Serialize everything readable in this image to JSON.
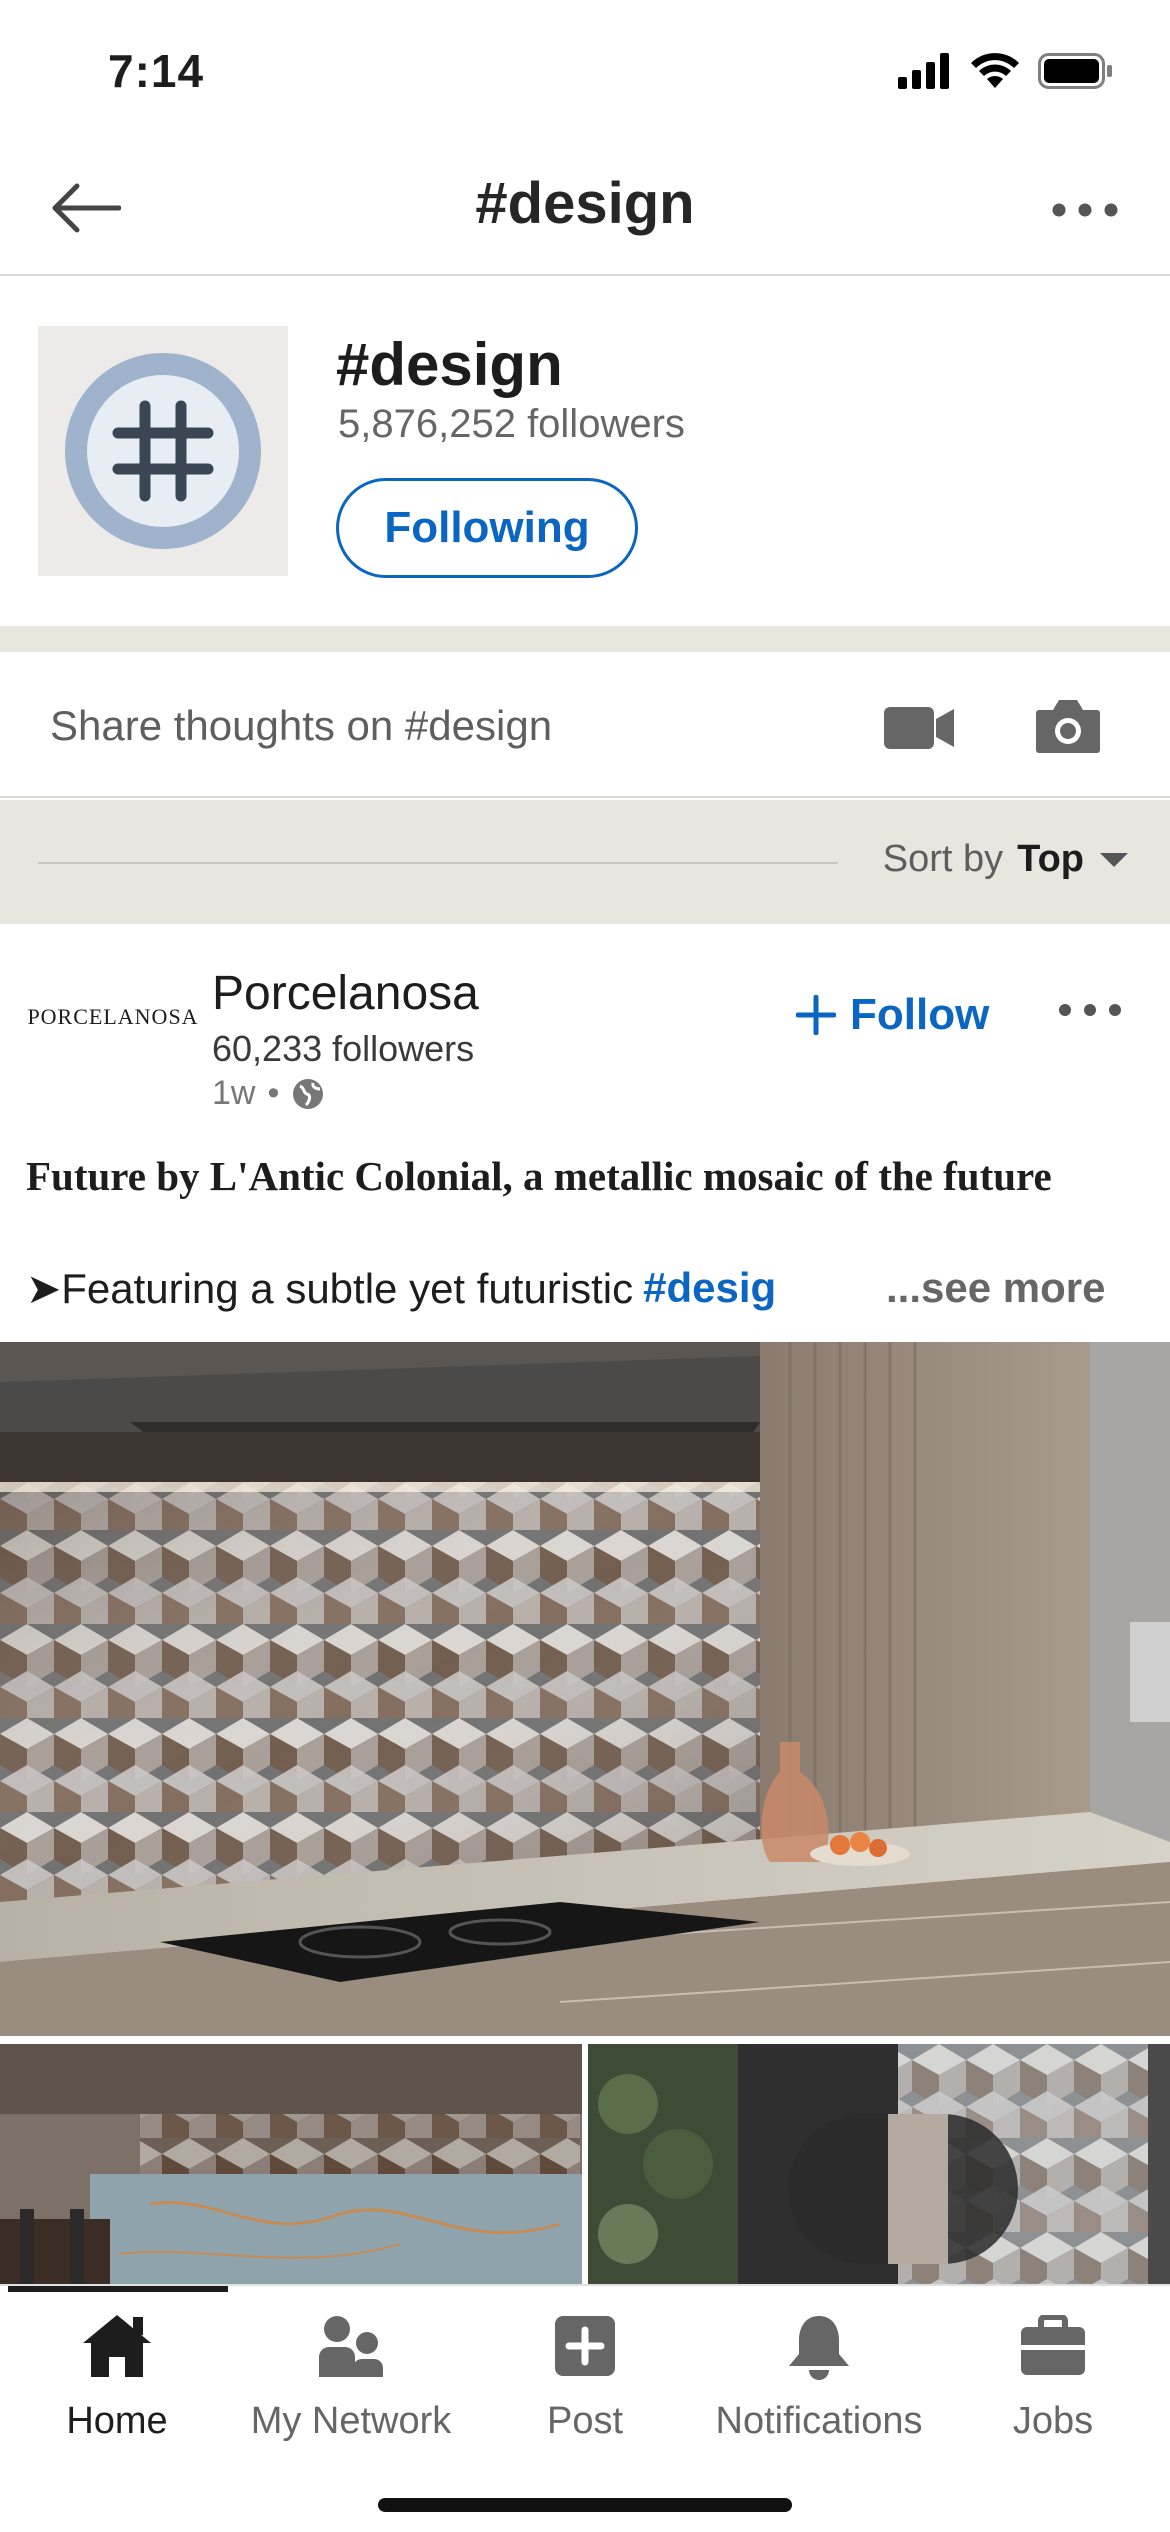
{
  "status_bar": {
    "time": "7:14"
  },
  "header": {
    "title": "#design",
    "back_icon": "arrow-left-icon",
    "more_icon": "ellipsis-icon"
  },
  "hashtag": {
    "name": "#design",
    "followers": "5,876,252 followers",
    "following_label": "Following",
    "logo_icon": "hashtag-icon"
  },
  "share": {
    "placeholder": "Share thoughts on #design",
    "video_icon": "video-camera-icon",
    "camera_icon": "camera-icon"
  },
  "sort": {
    "label": "Sort by",
    "value": "Top"
  },
  "post": {
    "company_logo_text": "PORCELANOSA",
    "company": "Porcelanosa",
    "followers": "60,233 followers",
    "age": "1w",
    "separator": "•",
    "visibility_icon": "globe-icon",
    "follow_label": "Follow",
    "headline": "Future by L'Antic Colonial, a metallic mosaic of the future",
    "body_prefix": "➤Featuring a subtle yet futuristic",
    "body_tag": "#desig",
    "see_more": "...see more"
  },
  "tabs": [
    {
      "label": "Home",
      "icon": "home-icon",
      "active": true
    },
    {
      "label": "My Network",
      "icon": "people-icon",
      "active": false
    },
    {
      "label": "Post",
      "icon": "plus-box-icon",
      "active": false
    },
    {
      "label": "Notifications",
      "icon": "bell-icon",
      "active": false
    },
    {
      "label": "Jobs",
      "icon": "briefcase-icon",
      "active": false
    }
  ],
  "colors": {
    "brand_blue": "#0a66c2",
    "band": "#e9e5df",
    "text": "#1d1d1d",
    "muted": "#666666"
  }
}
